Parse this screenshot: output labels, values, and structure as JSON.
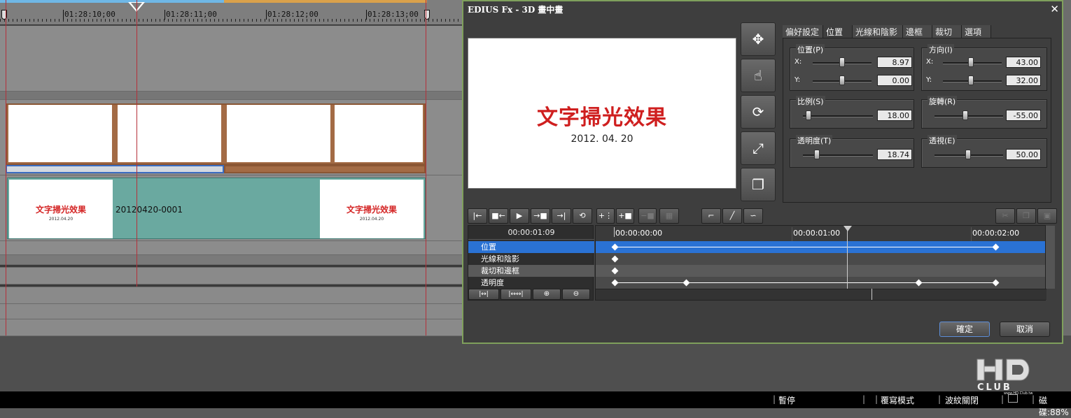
{
  "timeline": {
    "ruler_labels": [
      "01:28:10;00",
      "01:28:11;00",
      "01:28:12;00",
      "01:28:13;00"
    ],
    "clip_name": "20120420-0001",
    "thumb_title": "文字掃光效果",
    "thumb_date": "2012.04.20"
  },
  "dialog": {
    "title": "EDIUS Fx - 3D 畫中畫",
    "close": "✕",
    "preview_title": "文字掃光效果",
    "preview_date": "2012. 04. 20",
    "tabs": [
      "偏好設定",
      "位置",
      "光線和陰影",
      "邊框",
      "裁切",
      "選項"
    ],
    "active_tab": "位置",
    "groups": {
      "position": {
        "label": "位置(P)",
        "x_label": "X:",
        "y_label": "Y:",
        "x": "8.97",
        "y": "0.00"
      },
      "direction": {
        "label": "方向(I)",
        "x_label": "X:",
        "y_label": "Y:",
        "x": "43.00",
        "y": "32.00"
      },
      "scale": {
        "label": "比例(S)",
        "value": "18.00"
      },
      "rotate": {
        "label": "旋轉(R)",
        "value": "-55.00"
      },
      "opacity": {
        "label": "透明度(T)",
        "value": "18.74"
      },
      "perspective": {
        "label": "透視(E)",
        "value": "50.00"
      }
    },
    "kf_current_time": "00:00:01:09",
    "kf_tracks": [
      "位置",
      "光線和陰影",
      "裁切和邊框",
      "透明度"
    ],
    "kf_times": [
      "00:00:00:00",
      "00:00:01:00",
      "00:00:02:00"
    ],
    "ok": "確定",
    "cancel": "取消"
  },
  "statusbar": {
    "pause": "暫停",
    "mode": "覆寫模式",
    "waveform": "波紋關閉",
    "disk": "磁碟:88%"
  },
  "logo": {
    "text": "HD CLUB",
    "url": "www.HD.Club.tw"
  }
}
